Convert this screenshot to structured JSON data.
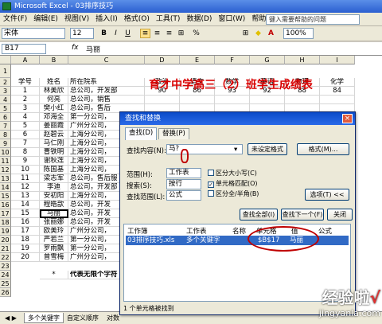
{
  "window": {
    "title": "Microsoft Excel - 03排序技巧"
  },
  "menu": [
    "文件(F)",
    "编辑(E)",
    "视图(V)",
    "插入(I)",
    "格式(O)",
    "工具(T)",
    "数据(D)",
    "窗口(W)",
    "帮助(H)"
  ],
  "question_box": "键入需要帮助的问题",
  "toolbar": {
    "font": "宋体",
    "size": "12",
    "bold": "B",
    "italic": "I",
    "underline": "U",
    "zoom": "100%"
  },
  "formula": {
    "name_box": "B17",
    "fx": "fx",
    "value": "马丽"
  },
  "columns": [
    "A",
    "B",
    "C",
    "D",
    "E",
    "F",
    "G",
    "H",
    "I"
  ],
  "rows": [
    "1",
    "2",
    "3",
    "4",
    "5",
    "6",
    "7",
    "8",
    "9",
    "10",
    "11",
    "12",
    "13",
    "14",
    "15",
    "16",
    "17",
    "18",
    "19",
    "20",
    "21",
    "22",
    "23",
    "24",
    "25",
    "26"
  ],
  "sheet": {
    "title": "育才中学高三（2）班学生成绩表",
    "headers": [
      "学号",
      "姓名",
      "所在院系",
      "政治",
      "语文",
      "数学",
      "英语",
      "物理",
      "化学"
    ],
    "data": [
      [
        "1",
        "林美欣",
        "总公司，开发部",
        "90",
        "86",
        "93",
        "92",
        "88",
        "84"
      ],
      [
        "2",
        "何亮",
        "总公司，销售",
        "",
        "",
        "",
        "",
        "",
        ""
      ],
      [
        "3",
        "樊小红",
        "总公司，售后",
        "",
        "",
        "",
        "",
        "",
        ""
      ],
      [
        "4",
        "邓海全",
        "第一分公司，",
        "",
        "",
        "",
        "",
        "",
        ""
      ],
      [
        "5",
        "姜丽霞",
        "广州分公司，",
        "",
        "",
        "",
        "",
        "",
        ""
      ],
      [
        "6",
        "赵碧云",
        "上海分公司，",
        "",
        "",
        "",
        "",
        "",
        ""
      ],
      [
        "7",
        "马仁刚",
        "上海分公司，",
        "",
        "",
        "",
        "",
        "",
        ""
      ],
      [
        "8",
        "曹铁明",
        "上海分公司，",
        "",
        "",
        "",
        "",
        "",
        ""
      ],
      [
        "9",
        "谢秋莲",
        "上海分公司，",
        "",
        "",
        "",
        "",
        "",
        ""
      ],
      [
        "10",
        "陈国基",
        "上海分公司，",
        "",
        "",
        "",
        "",
        "",
        ""
      ],
      [
        "11",
        "梁志军",
        "总公司，售后服",
        "",
        "",
        "",
        "",
        "",
        ""
      ],
      [
        "12",
        "李迪",
        "总公司，开发部",
        "",
        "",
        "",
        "",
        "",
        ""
      ],
      [
        "13",
        "安初阳",
        "上海分公司，",
        "",
        "",
        "",
        "",
        "",
        ""
      ],
      [
        "14",
        "程皓歆",
        "总公司，开发",
        "",
        "",
        "",
        "",
        "",
        ""
      ],
      [
        "15",
        "马丽",
        "总公司，开发",
        "",
        "",
        "",
        "",
        "",
        ""
      ],
      [
        "16",
        "张丽娜",
        "总公司，开发",
        "",
        "",
        "",
        "",
        "",
        ""
      ],
      [
        "17",
        "欧美玲",
        "广州分公司，",
        "",
        "",
        "",
        "",
        "",
        ""
      ],
      [
        "18",
        "严若兰",
        "第一分公司，",
        "",
        "",
        "",
        "",
        "",
        ""
      ],
      [
        "19",
        "罗雨飘",
        "第一分公司，",
        "",
        "",
        "",
        "",
        "",
        ""
      ],
      [
        "20",
        "曾雪梅",
        "广州分公司，",
        "",
        "",
        "",
        "",
        "",
        ""
      ]
    ],
    "footer_star": "*",
    "footer_text": "代表无限个字符"
  },
  "tabs": [
    "多个关键字",
    "自定义顺序",
    "对数"
  ],
  "dialog": {
    "title": "查找和替换",
    "close": "×",
    "tab_find": "查找(D)",
    "tab_replace": "替换(P)",
    "find_label": "查找内容(N):",
    "find_value": "马?",
    "format_status": "未设定格式",
    "format_button": "格式(M)...",
    "scope_label": "范围(H):",
    "scope_value": "工作表",
    "search_label": "搜索(S):",
    "search_value": "按行",
    "lookin_label": "查找范围(L):",
    "lookin_value": "公式",
    "match_case": "区分大小写(C)",
    "match_cell": "单元格匹配(O)",
    "match_width": "区分全/半角(B)",
    "options_button": "选项(T) <<",
    "find_all": "查找全部(I)",
    "find_next": "查找下一个(F)",
    "close_button": "关闭",
    "col_book": "工作簿",
    "col_sheet": "工作表",
    "col_name": "名称",
    "col_cell": "单元格",
    "col_value": "值",
    "col_formula": "公式",
    "result": {
      "book": "03排序技巧.xls",
      "sheet": "多个关键字",
      "cell": "$B$17",
      "value": "马丽"
    },
    "status": "1 个单元格被找到"
  },
  "watermark": {
    "brand": "经验啦",
    "check": "√",
    "url": "jingyanla.com"
  }
}
